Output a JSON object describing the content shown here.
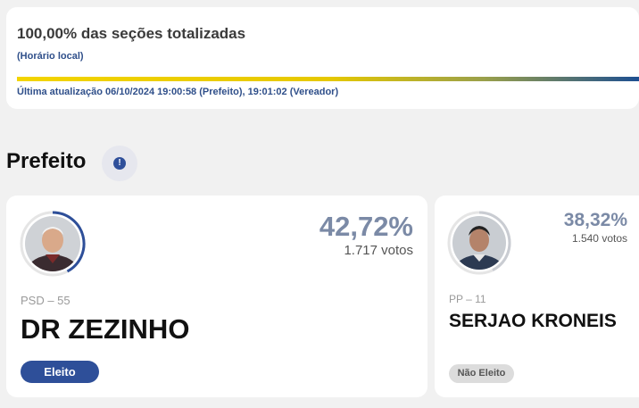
{
  "status": {
    "title": "100,00% das seções totalizadas",
    "timezone_note": "(Horário local)",
    "progress_percent": 100,
    "last_update": "Última atualização 06/10/2024 19:00:58 (Prefeito), 19:01:02 (Vereador)"
  },
  "section": {
    "title": "Prefeito",
    "info_icon": "!"
  },
  "candidates": [
    {
      "party": "PSD – 55",
      "name": "DR ZEZINHO",
      "percent": "42,72%",
      "votes": "1.717 votos",
      "status": "Eleito"
    },
    {
      "party": "PP – 11",
      "name": "SERJAO KRONEIS",
      "percent": "38,32%",
      "votes": "1.540 votos",
      "status": "Não Eleito"
    }
  ],
  "colors": {
    "accent": "#2e4f99",
    "percent_text": "#7b8aa6",
    "progress_start": "#f3d400",
    "progress_end": "#1d4f91"
  }
}
